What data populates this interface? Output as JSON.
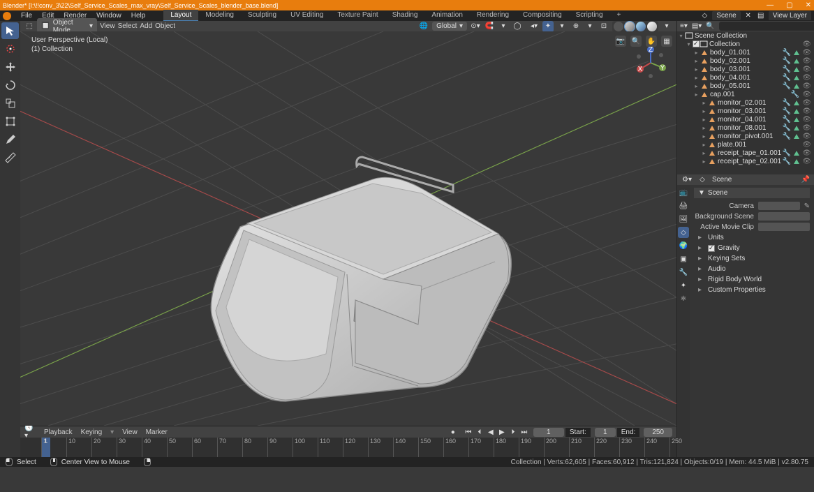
{
  "titlebar": {
    "title": "Blender* [I:\\!!conv_3\\22\\Self_Service_Scales_max_vray\\Self_Service_Scales_blender_base.blend]"
  },
  "topmenu": {
    "file": "File",
    "edit": "Edit",
    "render": "Render",
    "window": "Window",
    "help": "Help"
  },
  "workspaces": [
    "Layout",
    "Modeling",
    "Sculpting",
    "UV Editing",
    "Texture Paint",
    "Shading",
    "Animation",
    "Rendering",
    "Compositing",
    "Scripting"
  ],
  "active_workspace": "Layout",
  "scene_name": "Scene",
  "view_layer": "View Layer",
  "viewport_header": {
    "mode": "Object Mode",
    "view": "View",
    "select": "Select",
    "add": "Add",
    "object": "Object",
    "orientation": "Global"
  },
  "viewport_info": {
    "line1": "User Perspective (Local)",
    "line2": "(1) Collection"
  },
  "playback_menus": {
    "playback": "Playback",
    "keying": "Keying",
    "view": "View",
    "marker": "Marker"
  },
  "frame_current": 1,
  "frame_start_label": "Start:",
  "frame_start": 1,
  "frame_end_label": "End:",
  "frame_end": 250,
  "outliner": {
    "root": "Scene Collection",
    "collection": "Collection",
    "items": [
      {
        "label": "body_01.001",
        "mod": true,
        "sel": true
      },
      {
        "label": "body_02.001",
        "mod": true,
        "sel": true
      },
      {
        "label": "body_03.001",
        "mod": true,
        "sel": true
      },
      {
        "label": "body_04.001",
        "mod": true,
        "sel": true
      },
      {
        "label": "body_05.001",
        "mod": true,
        "sel": true
      },
      {
        "label": "cap.001",
        "mod": true,
        "sel": false
      },
      {
        "label": "monitor_02.001",
        "mod": true,
        "sel": true,
        "ind": 1
      },
      {
        "label": "monitor_03.001",
        "mod": true,
        "sel": true,
        "ind": 1
      },
      {
        "label": "monitor_04.001",
        "mod": true,
        "sel": true,
        "ind": 1
      },
      {
        "label": "monitor_08.001",
        "mod": true,
        "sel": true,
        "ind": 1
      },
      {
        "label": "monitor_pivot.001",
        "mod": true,
        "sel": true,
        "ind": 1
      },
      {
        "label": "plate.001",
        "mod": false,
        "sel": false,
        "ind": 1
      },
      {
        "label": "receipt_tape_01.001",
        "mod": true,
        "sel": true,
        "ind": 1
      },
      {
        "label": "receipt_tape_02.001",
        "mod": true,
        "sel": true,
        "ind": 1
      }
    ]
  },
  "props": {
    "context": "Scene",
    "panel_title": "Scene",
    "camera": "Camera",
    "bg_scene": "Background Scene",
    "movie_clip": "Active Movie Clip",
    "units": "Units",
    "gravity": "Gravity",
    "keying_sets": "Keying Sets",
    "audio": "Audio",
    "rigid": "Rigid Body World",
    "custom": "Custom Properties"
  },
  "search_placeholder": "",
  "status": {
    "select": "Select",
    "center": "Center View to Mouse",
    "stats": "Collection | Verts:62,605 | Faces:60,912 | Tris:121,824 | Objects:0/19 | Mem: 44.5 MiB | v2.80.75"
  },
  "ruler_ticks": [
    1,
    10,
    20,
    30,
    40,
    50,
    60,
    70,
    80,
    90,
    100,
    110,
    120,
    130,
    140,
    150,
    160,
    170,
    180,
    190,
    200,
    210,
    220,
    230,
    240,
    250
  ]
}
